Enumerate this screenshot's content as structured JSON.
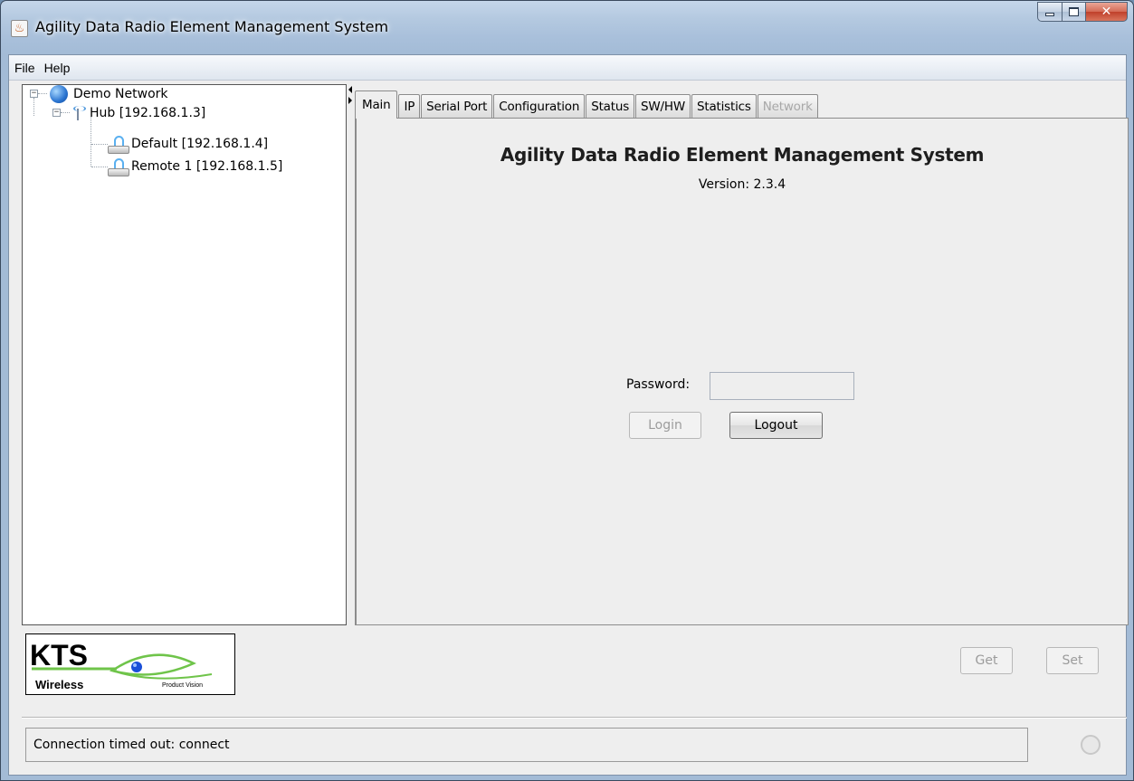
{
  "window": {
    "title": "Agility Data Radio Element Management System",
    "icon": "java-app-icon",
    "controls": [
      "minimize",
      "maximize",
      "close"
    ]
  },
  "menubar": {
    "items": [
      "File",
      "Help"
    ]
  },
  "tree": {
    "root": {
      "label": "Demo Network",
      "icon": "globe-icon",
      "expanded": true,
      "children": [
        {
          "label": "Hub [192.168.1.3]",
          "icon": "tower-icon",
          "expanded": true,
          "children": [
            {
              "label": "Default [192.168.1.4]",
              "icon": "radio-icon"
            },
            {
              "label": "Remote 1 [192.168.1.5]",
              "icon": "radio-icon"
            }
          ]
        }
      ]
    }
  },
  "tabs": [
    {
      "label": "Main",
      "active": true,
      "enabled": true
    },
    {
      "label": "IP",
      "active": false,
      "enabled": true
    },
    {
      "label": "Serial Port",
      "active": false,
      "enabled": true
    },
    {
      "label": "Configuration",
      "active": false,
      "enabled": true
    },
    {
      "label": "Status",
      "active": false,
      "enabled": true
    },
    {
      "label": "SW/HW",
      "active": false,
      "enabled": true
    },
    {
      "label": "Statistics",
      "active": false,
      "enabled": true
    },
    {
      "label": "Network",
      "active": false,
      "enabled": false
    }
  ],
  "main": {
    "heading": "Agility Data Radio Element Management System",
    "version_text": "Version: 2.3.4",
    "password_label": "Password:",
    "password_value": "",
    "login_label": "Login",
    "login_enabled": false,
    "logout_label": "Logout",
    "logout_enabled": true
  },
  "logo": {
    "brand": "KTS",
    "sub": "Wireless",
    "tagline": "Product Vision",
    "colors": {
      "line": "#6fc44a",
      "eye": "#1a4fd8"
    }
  },
  "actions": {
    "get_label": "Get",
    "set_label": "Set",
    "get_enabled": false,
    "set_enabled": false
  },
  "status": {
    "message": "Connection timed out: connect",
    "indicator": "idle"
  }
}
